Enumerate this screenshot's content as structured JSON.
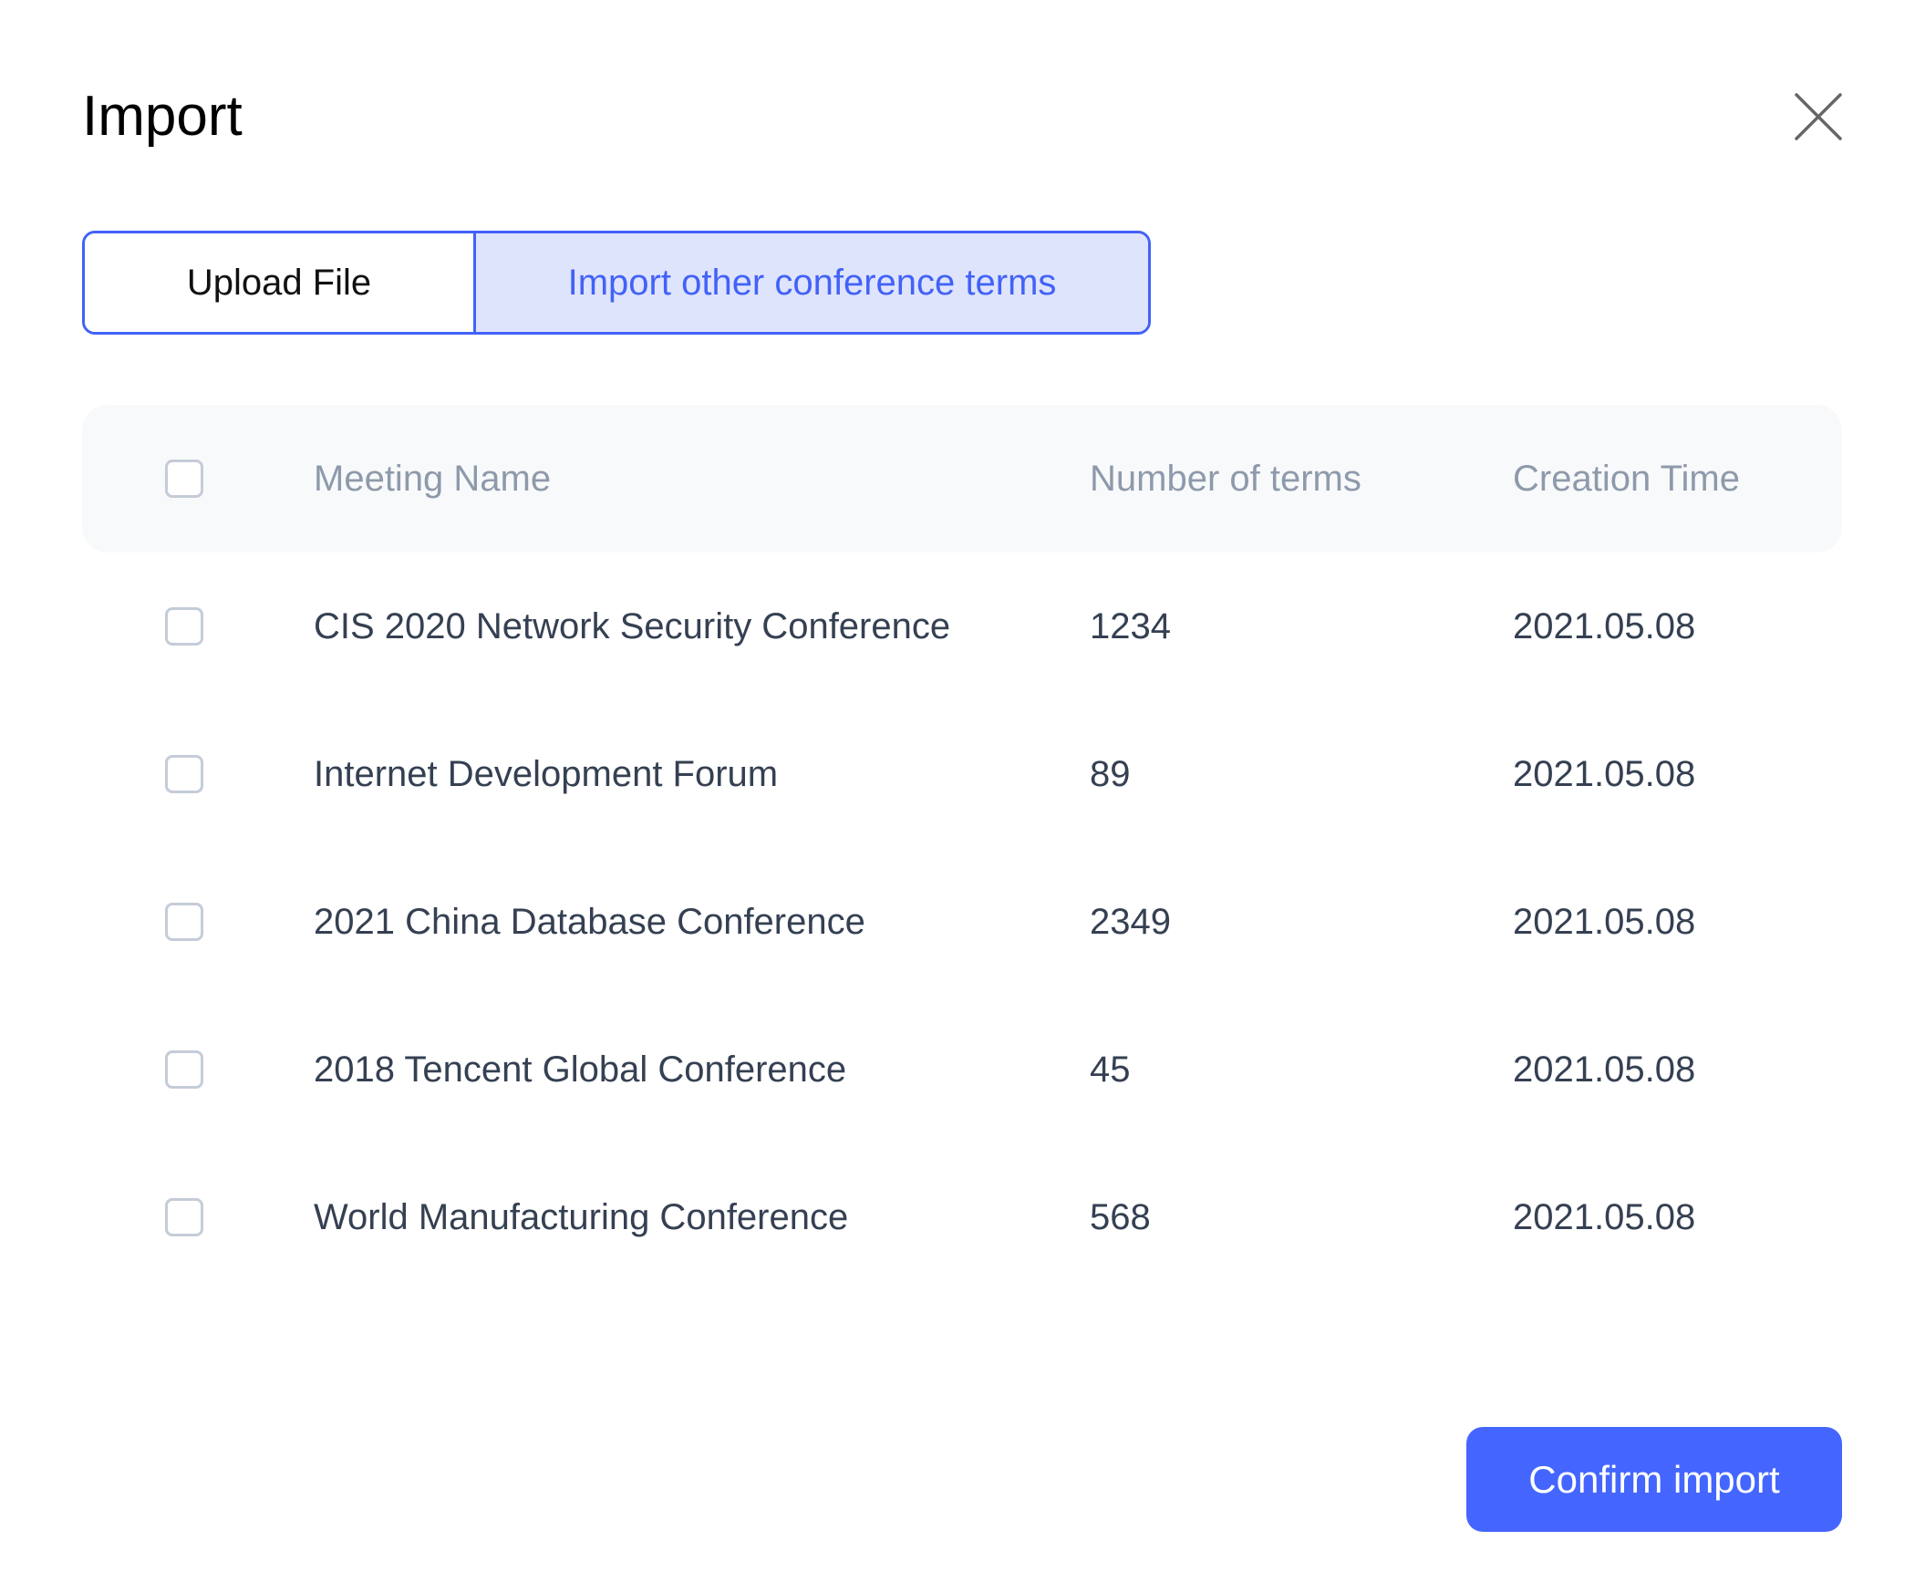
{
  "dialog": {
    "title": "Import",
    "close_icon": "close-icon"
  },
  "tabs": [
    {
      "label": "Upload File",
      "active": false
    },
    {
      "label": "Import other conference terms",
      "active": true
    }
  ],
  "table": {
    "columns": [
      "Meeting Name",
      "Number of terms",
      "Creation Time"
    ],
    "rows": [
      {
        "name": "CIS 2020 Network Security Conference",
        "terms": "1234",
        "created": "2021.05.08",
        "checked": false
      },
      {
        "name": "Internet Development Forum",
        "terms": "89",
        "created": "2021.05.08",
        "checked": false
      },
      {
        "name": "2021 China Database Conference",
        "terms": "2349",
        "created": "2021.05.08",
        "checked": false
      },
      {
        "name": "2018 Tencent Global Conference",
        "terms": "45",
        "created": "2021.05.08",
        "checked": false
      },
      {
        "name": "World Manufacturing Conference",
        "terms": "568",
        "created": "2021.05.08",
        "checked": false
      }
    ]
  },
  "footer": {
    "confirm_label": "Confirm import"
  },
  "colors": {
    "accent": "#4466ff",
    "tab_border": "#4262f7",
    "tab_active_bg": "#dfe4fd",
    "header_bg": "#f8f9fa",
    "header_text": "#8e9aab",
    "cell_text": "#354052"
  }
}
